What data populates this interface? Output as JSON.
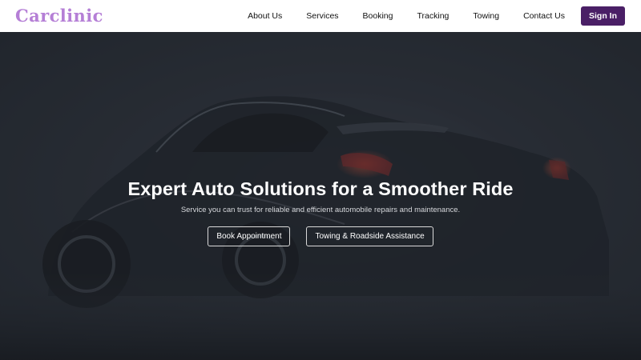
{
  "brand": {
    "name": "Carclinic",
    "color": "#b57fd6"
  },
  "nav": {
    "links": [
      "About Us",
      "Services",
      "Booking",
      "Tracking",
      "Towing",
      "Contact Us"
    ],
    "signin_label": "Sign In",
    "signin_color": "#4a1f66"
  },
  "hero": {
    "title": "Expert Auto Solutions for a Smoother Ride",
    "subtitle": "Service you can trust for reliable and efficient automobile repairs and maintenance.",
    "primary_button": "Book Appointment",
    "secondary_button": "Towing & Roadside Assistance",
    "background_image": "dark-sports-car"
  }
}
